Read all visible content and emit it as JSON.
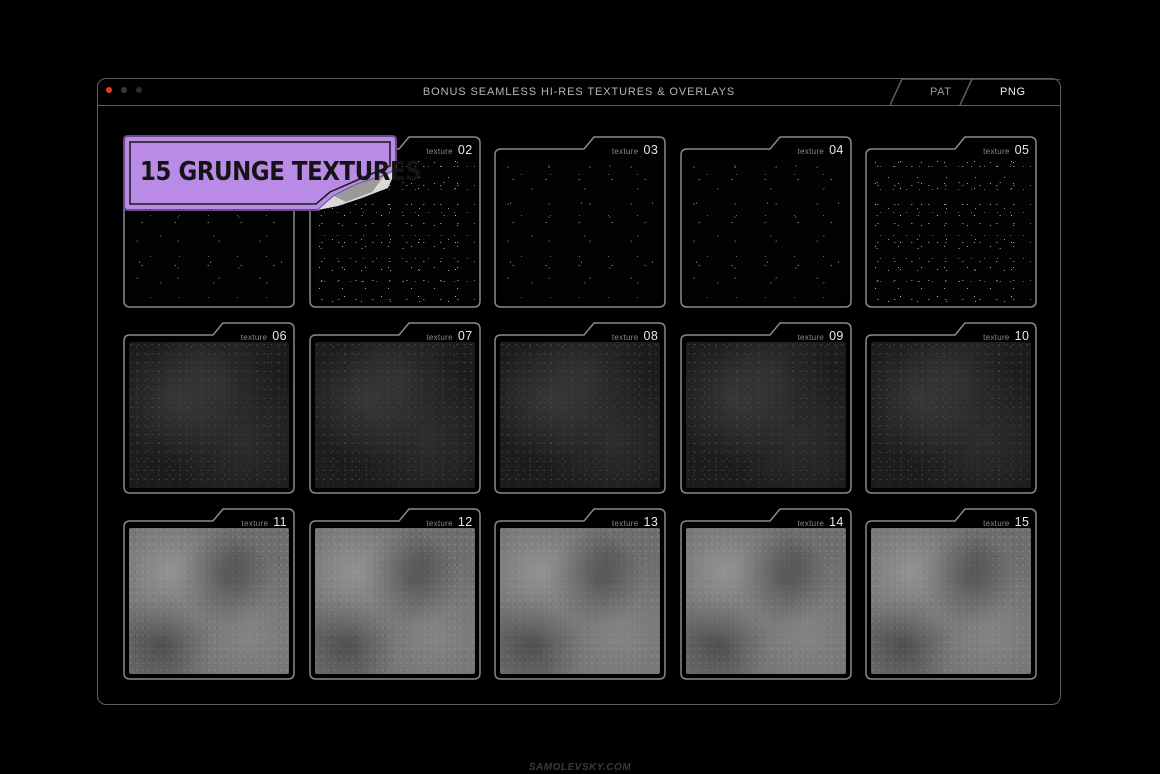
{
  "window": {
    "title": "BONUS SEAMLESS HI-RES TEXTURES & OVERLAYS",
    "tabs": [
      {
        "label": "PAT",
        "active": false
      },
      {
        "label": "PNG",
        "active": true
      }
    ]
  },
  "sticker": {
    "label": "15 GRUNGE TEXTURES",
    "color": "#b98ae6"
  },
  "cards": [
    {
      "prefix": "",
      "number": "",
      "tone": "dark1 sparse"
    },
    {
      "prefix": "texture",
      "number": "02",
      "tone": "dark1"
    },
    {
      "prefix": "texture",
      "number": "03",
      "tone": "dark1 sparse"
    },
    {
      "prefix": "texture",
      "number": "04",
      "tone": "dark1 sparse"
    },
    {
      "prefix": "texture",
      "number": "05",
      "tone": "dark1"
    },
    {
      "prefix": "texture",
      "number": "06",
      "tone": "mid"
    },
    {
      "prefix": "texture",
      "number": "07",
      "tone": "mid"
    },
    {
      "prefix": "texture",
      "number": "08",
      "tone": "mid"
    },
    {
      "prefix": "texture",
      "number": "09",
      "tone": "mid"
    },
    {
      "prefix": "texture",
      "number": "10",
      "tone": "mid"
    },
    {
      "prefix": "texture",
      "number": "11",
      "tone": "light"
    },
    {
      "prefix": "texture",
      "number": "12",
      "tone": "light"
    },
    {
      "prefix": "texture",
      "number": "13",
      "tone": "light"
    },
    {
      "prefix": "texture",
      "number": "14",
      "tone": "light"
    },
    {
      "prefix": "texture",
      "number": "15",
      "tone": "light"
    }
  ],
  "footer": {
    "text": "SAMOLEVSKY.COM"
  }
}
